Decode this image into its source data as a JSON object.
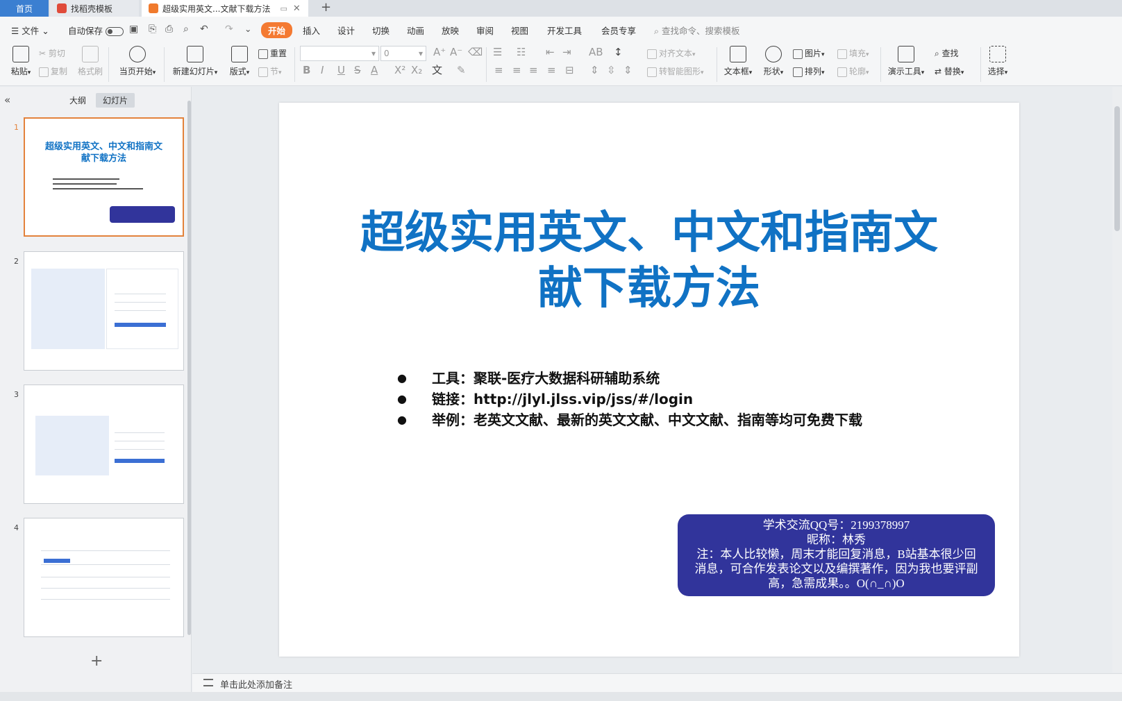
{
  "tabs": {
    "home": "首页",
    "template": "找稻壳模板",
    "doc": "超级实用英文...文献下载方法",
    "add": "+"
  },
  "menu": {
    "file": "文件",
    "autosave": "自动保存",
    "items": [
      "开始",
      "插入",
      "设计",
      "切换",
      "动画",
      "放映",
      "审阅",
      "视图",
      "开发工具",
      "会员专享"
    ],
    "search_placeholder": "查找命令、搜索模板"
  },
  "ribbon": {
    "paste": "粘贴",
    "cut": "剪切",
    "copy": "复制",
    "format_painter": "格式刷",
    "from_current": "当页开始",
    "new_slide": "新建幻灯片",
    "layout": "版式",
    "reset": "重置",
    "section": "节",
    "font_size": "0",
    "align_text": "对齐文本",
    "smart_art": "转智能图形",
    "text_box": "文本框",
    "shape": "形状",
    "picture": "图片",
    "arrange": "排列",
    "fill": "填充",
    "outline": "轮廓",
    "present_tools": "演示工具",
    "find": "查找",
    "replace": "替换",
    "select": "选择"
  },
  "left_panel": {
    "outline_tab": "大纲",
    "slides_tab": "幻灯片",
    "slide_numbers": [
      "1",
      "2",
      "3",
      "4"
    ],
    "thumb1_title": "超级实用英文、中文和指南文献下载方法",
    "add_slide": "+"
  },
  "slide": {
    "title_line1": "超级实用英文、中文和指南文",
    "title_line2": "献下载方法",
    "bullets": [
      "工具：聚联-医疗大数据科研辅助系统",
      "链接：http://jlyl.jlss.vip/jss/#/login",
      "举例：老英文文献、最新的英文文献、中文文献、指南等均可免费下载"
    ],
    "qq_box": {
      "line1": "学术交流QQ号：2199378997",
      "line2": "昵称：林秀",
      "line3": "注：本人比较懒，周末才能回复消息，B站基本很少回消息，可合作发表论文以及编撰著作，因为我也要评副高，急需成果。。O(∩_∩)O"
    }
  },
  "notes": {
    "placeholder": "单击此处添加备注"
  },
  "colors": {
    "accent_orange": "#f47a32",
    "title_blue": "#1072c4",
    "qq_box_bg": "#31349b",
    "home_tab": "#3b7fd1"
  }
}
